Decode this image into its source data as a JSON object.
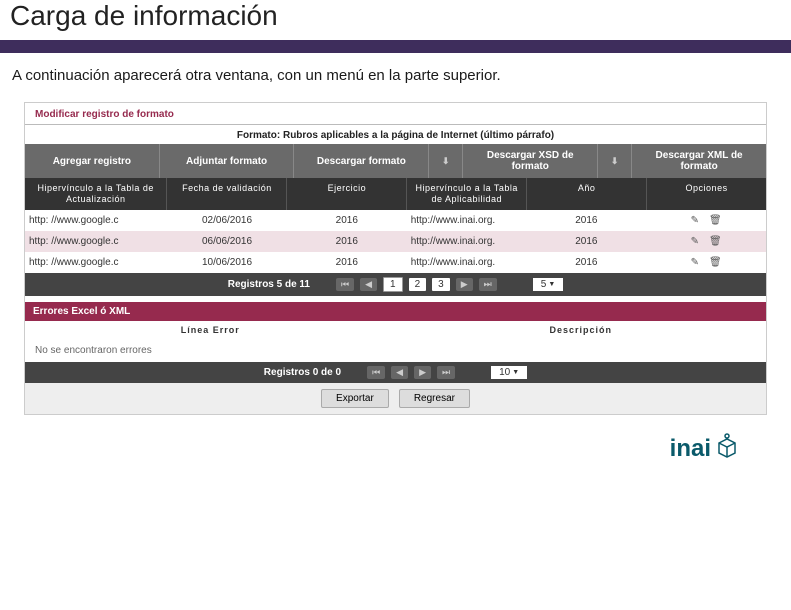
{
  "page": {
    "title": "Carga de información",
    "subtitle": "A continuación aparecerá otra ventana, con un menú en la parte superior."
  },
  "app": {
    "section_title": "Modificar registro de formato",
    "format_label": "Formato: Rubros aplicables a la página de Internet (último párrafo)",
    "toolbar": {
      "add": "Agregar registro",
      "attach": "Adjuntar formato",
      "download_fmt": "Descargar formato",
      "download_xsd": "Descargar XSD de formato",
      "download_xml": "Descargar XML de formato"
    },
    "columns": {
      "c1": "Hipervínculo a la Tabla de Actualización",
      "c2": "Fecha de validación",
      "c3": "Ejercicio",
      "c4": "Hipervínculo a la Tabla de Aplicabilidad",
      "c5": "Año",
      "c6": "Opciones"
    },
    "rows": [
      {
        "link1": "http: //www.google.c",
        "date": "02/06/2016",
        "year1": "2016",
        "link2": "http://www.inai.org.",
        "year2": "2016"
      },
      {
        "link1": "http: //www.google.c",
        "date": "06/06/2016",
        "year1": "2016",
        "link2": "http://www.inai.org.",
        "year2": "2016"
      },
      {
        "link1": "http: //www.google.c",
        "date": "10/06/2016",
        "year1": "2016",
        "link2": "http://www.inai.org.",
        "year2": "2016"
      }
    ],
    "pager1": {
      "label": "Registros 5 de 11",
      "pages": [
        "1",
        "2",
        "3"
      ],
      "page_size": "5"
    },
    "errors": {
      "title": "Errores Excel ó XML",
      "col1": "Línea Error",
      "col2": "Descripción",
      "empty": "No se encontraron errores"
    },
    "pager2": {
      "label": "Registros 0 de 0",
      "page_size": "10"
    },
    "actions": {
      "export": "Exportar",
      "back": "Regresar"
    }
  },
  "footer": {
    "logo": "inai"
  }
}
